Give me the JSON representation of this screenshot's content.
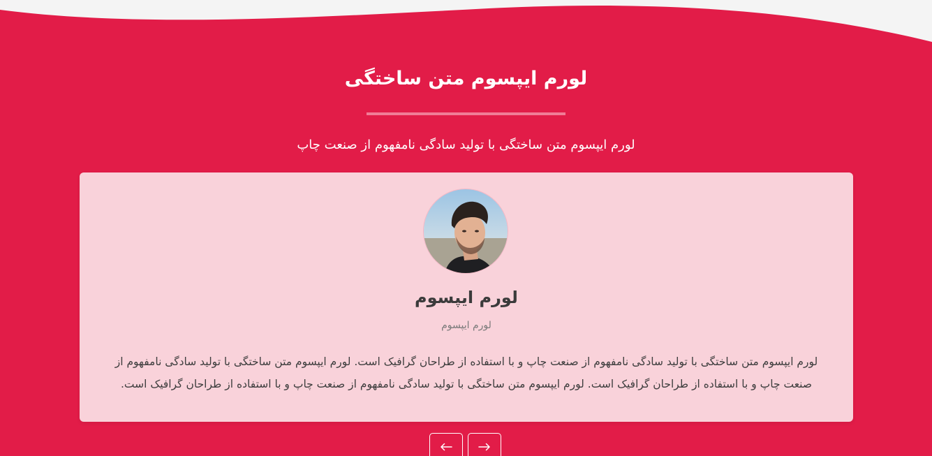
{
  "section": {
    "title": "لورم ایپسوم متن ساختگی",
    "subtitle": "لورم ایپسوم متن ساختگی با تولید سادگی نامفهوم از صنعت چاپ"
  },
  "testimonial": {
    "name": "لورم ایپسوم",
    "role": "لورم ایپسوم",
    "text": "لورم ایپسوم متن ساختگی با تولید سادگی نامفهوم از صنعت چاپ و با استفاده از طراحان گرافیک است. لورم ایپسوم متن ساختگی با تولید سادگی نامفهوم از صنعت چاپ و با استفاده از طراحان گرافیک است. لورم ایپسوم متن ساختگی با تولید سادگی نامفهوم از صنعت چاپ و با استفاده از طراحان گرافیک است.",
    "avatar_icon": "person-photo"
  },
  "navigation": {
    "prev_icon": "arrow-left-icon",
    "next_icon": "arrow-right-icon"
  },
  "colors": {
    "background": "#e21c48",
    "card": "#f9d2da",
    "top_wave": "#f4f4f4",
    "underline": "#f07c96",
    "text_light": "#ffffff",
    "name_text": "#3b3b3b",
    "role_text": "#7a7a7a"
  }
}
